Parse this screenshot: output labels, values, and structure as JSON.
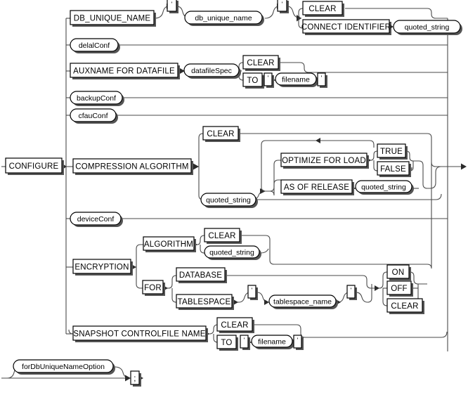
{
  "diagram": {
    "type": "railroad-syntax-diagram",
    "name": "CONFIGURE clause",
    "entry_terminal": "CONFIGURE",
    "terminator": ";",
    "colors": {
      "background": "#ffffff",
      "line": "#4a4a4a",
      "box_stroke": "#000000",
      "box_fill": "#ffffff",
      "shadow": "#555555",
      "text": "#000000"
    },
    "start": {
      "label": "CONFIGURE",
      "kind": "keyword"
    },
    "branches": [
      {
        "id": "db-unique-name",
        "label": "DB_UNIQUE_NAME",
        "kind": "keyword",
        "quote1": "'",
        "argument": "db_unique_name",
        "argument_kind": "nonterminal",
        "quote2": "'",
        "options": [
          {
            "label": "CLEAR",
            "kind": "keyword"
          },
          {
            "label": "CONNECT IDENTIFIER",
            "kind": "keyword",
            "argument": "quoted_string",
            "argument_kind": "nonterminal"
          }
        ]
      },
      {
        "id": "delal-conf",
        "label": "delalConf",
        "kind": "nonterminal"
      },
      {
        "id": "auxname-for-datafile",
        "label": "AUXNAME FOR DATAFILE",
        "kind": "keyword",
        "argument": "datafileSpec",
        "argument_kind": "nonterminal",
        "options": [
          {
            "label": "CLEAR",
            "kind": "keyword"
          },
          {
            "label": "TO",
            "kind": "keyword",
            "quote1": "'",
            "argument": "filename",
            "argument_kind": "nonterminal",
            "quote2": "'"
          }
        ]
      },
      {
        "id": "backup-conf",
        "label": "backupConf",
        "kind": "nonterminal"
      },
      {
        "id": "cfau-conf",
        "label": "cfauConf",
        "kind": "nonterminal"
      },
      {
        "id": "compression-algorithm",
        "label": "COMPRESSION ALGORITHM",
        "kind": "keyword",
        "options": [
          {
            "label": "CLEAR",
            "kind": "keyword"
          },
          {
            "label": "quoted_string",
            "kind": "nonterminal"
          }
        ],
        "suboptions": [
          {
            "label": "OPTIMIZE FOR LOAD",
            "kind": "keyword",
            "choices": [
              {
                "label": "TRUE",
                "kind": "keyword"
              },
              {
                "label": "FALSE",
                "kind": "keyword"
              }
            ]
          },
          {
            "label": "AS OF RELEASE",
            "kind": "keyword",
            "argument": "quoted_string",
            "argument_kind": "nonterminal"
          }
        ]
      },
      {
        "id": "device-conf",
        "label": "deviceConf",
        "kind": "nonterminal"
      },
      {
        "id": "encryption",
        "label": "ENCRYPTION",
        "kind": "keyword",
        "paths": [
          {
            "label": "ALGORITHM",
            "kind": "keyword",
            "choices": [
              {
                "label": "CLEAR",
                "kind": "keyword"
              },
              {
                "label": "quoted_string",
                "kind": "nonterminal"
              }
            ]
          },
          {
            "label": "FOR",
            "kind": "keyword",
            "choices": [
              {
                "label": "DATABASE",
                "kind": "keyword"
              },
              {
                "label": "TABLESPACE",
                "kind": "keyword",
                "quote1": "'",
                "argument": "tablespace_name",
                "argument_kind": "nonterminal",
                "quote2": "'"
              }
            ],
            "states": [
              {
                "label": "ON",
                "kind": "keyword"
              },
              {
                "label": "OFF",
                "kind": "keyword"
              },
              {
                "label": "CLEAR",
                "kind": "keyword"
              }
            ]
          }
        ]
      },
      {
        "id": "snapshot-controlfile-name",
        "label": "SNAPSHOT CONTROLFILE NAME",
        "kind": "keyword",
        "options": [
          {
            "label": "CLEAR",
            "kind": "keyword"
          },
          {
            "label": "TO",
            "kind": "keyword",
            "quote1": "'",
            "argument": "filename",
            "argument_kind": "nonterminal",
            "quote2": "'"
          }
        ]
      }
    ],
    "footer": {
      "optional_item": {
        "label": "forDbUniqueNameOption",
        "kind": "nonterminal"
      },
      "terminator": {
        "label": ";",
        "kind": "keyword"
      }
    }
  }
}
